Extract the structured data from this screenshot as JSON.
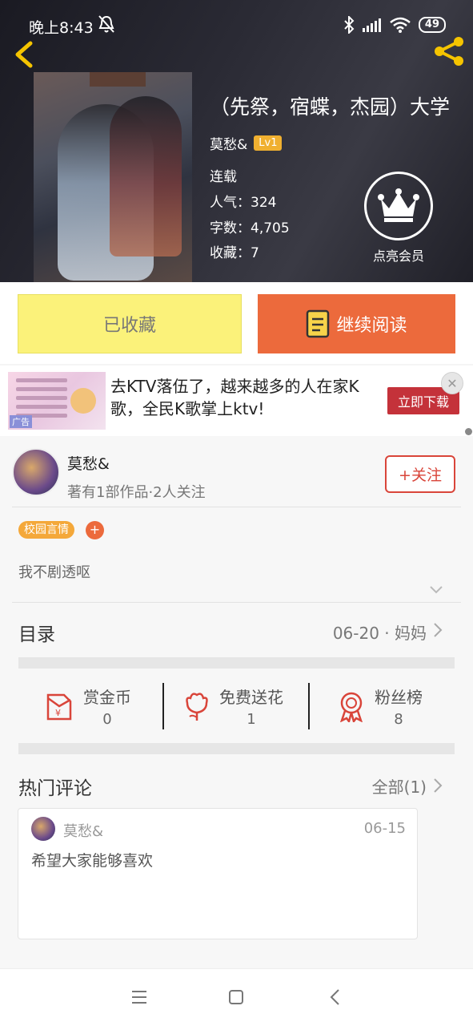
{
  "status": {
    "time": "晚上8:43",
    "battery": "49"
  },
  "book": {
    "title": "（先祭，宿蝶，杰园）大学",
    "author": "莫愁&",
    "level": "Lv1",
    "status": "连载",
    "popularity": "人气：324",
    "word_count": "字数：4,705",
    "favorites": "收藏：7",
    "vip_label": "点亮会员"
  },
  "actions": {
    "collected": "已收藏",
    "continue_reading": "继续阅读"
  },
  "ad": {
    "text": "去KTV落伍了，越来越多的人在家K歌，全民K歌掌上ktv!",
    "cta": "立即下载",
    "tag": "广告",
    "close": "✕"
  },
  "author_card": {
    "name": "莫愁&",
    "stats": "著有1部作品·2人关注",
    "follow": "+关注",
    "tag": "校园言情",
    "tag_add": "+",
    "intro": "我不剧透呕"
  },
  "toc": {
    "label": "目录",
    "latest": "06-20 · 妈妈"
  },
  "stats": [
    {
      "label": "赏金币",
      "value": "0",
      "icon": "red-envelope-icon"
    },
    {
      "label": "免费送花",
      "value": "1",
      "icon": "flower-icon"
    },
    {
      "label": "粉丝榜",
      "value": "8",
      "icon": "medal-icon"
    }
  ],
  "comments": {
    "label": "热门评论",
    "all": "全部(1)",
    "items": [
      {
        "user": "莫愁&",
        "date": "06-15",
        "text": "希望大家能够喜欢"
      }
    ]
  },
  "colors": {
    "accent": "#ec6a3c",
    "collected_bg": "#fbf27a",
    "follow": "#d9453a",
    "tag": "#f4a83a"
  }
}
